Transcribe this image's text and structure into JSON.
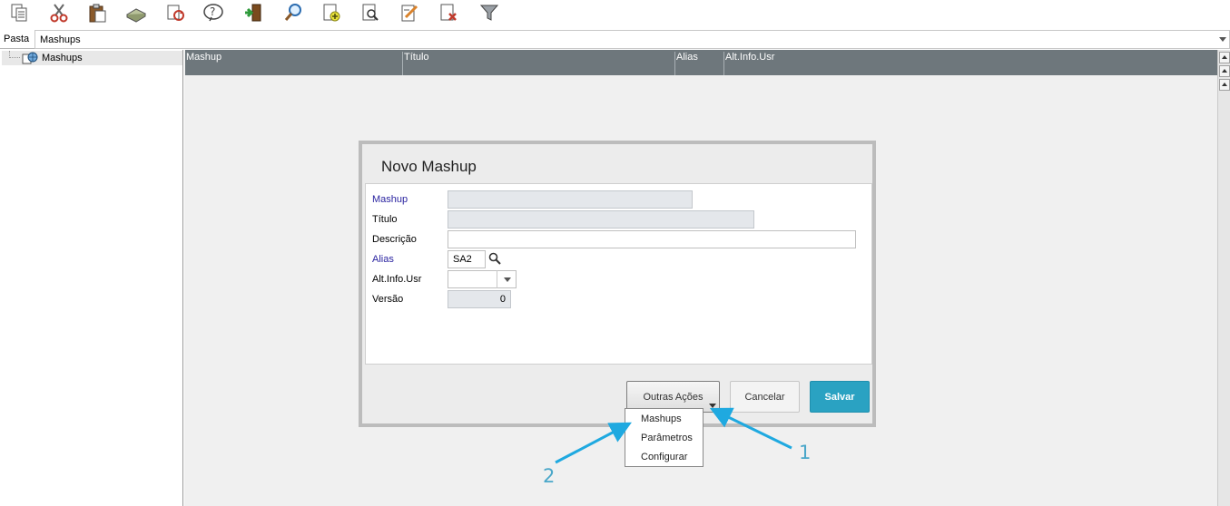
{
  "toolbar": {
    "icons": [
      "copy-icon",
      "cut-icon",
      "paste-icon",
      "print-icon",
      "refresh-icon",
      "help-icon",
      "exit-icon",
      "search-icon",
      "add-icon",
      "view-icon",
      "edit-icon",
      "delete-icon",
      "filter-icon"
    ]
  },
  "pasta": {
    "label": "Pasta",
    "value": "Mashups"
  },
  "tree": {
    "items": [
      {
        "label": "Mashups"
      }
    ]
  },
  "grid": {
    "columns": [
      "Mashup",
      "Título",
      "Alias",
      "Alt.Info.Usr"
    ]
  },
  "dialog": {
    "title": "Novo Mashup",
    "fields": {
      "mashup": {
        "label": "Mashup",
        "value": ""
      },
      "titulo": {
        "label": "Título",
        "value": ""
      },
      "descricao": {
        "label": "Descrição",
        "value": ""
      },
      "alias": {
        "label": "Alias",
        "value": "SA2"
      },
      "altinfo": {
        "label": "Alt.Info.Usr",
        "value": ""
      },
      "versao": {
        "label": "Versão",
        "value": "0"
      }
    },
    "buttons": {
      "outras": "Outras Ações",
      "cancel": "Cancelar",
      "save": "Salvar"
    }
  },
  "menu": {
    "items": [
      "Mashups",
      "Parâmetros",
      "Configurar"
    ]
  },
  "annotations": {
    "one": "1",
    "two": "2"
  },
  "colors": {
    "header": "#6e777c",
    "save": "#2aa2c2",
    "required_label": "#2a23a0",
    "annotation": "#4aa7c9"
  }
}
